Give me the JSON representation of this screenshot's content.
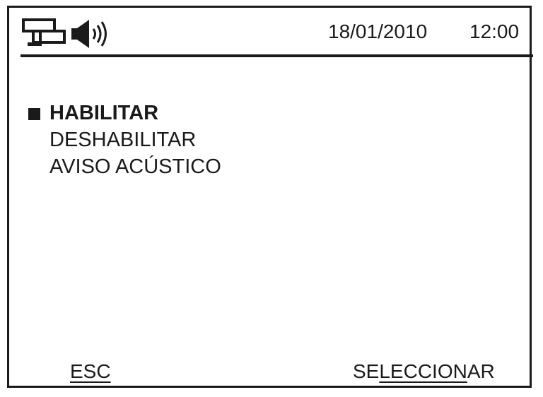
{
  "status_bar": {
    "network_icon": "network-icon",
    "speaker_icon": "speaker-icon",
    "date": "18/01/2010",
    "time": "12:00"
  },
  "menu": {
    "selected_index": 0,
    "items": [
      {
        "label": "HABILITAR",
        "selected": true
      },
      {
        "label": "DESHABILITAR",
        "selected": false
      },
      {
        "label": "AVISO ACÚSTICO",
        "selected": false
      }
    ]
  },
  "softkeys": {
    "left": {
      "label": "ESC"
    },
    "right": {
      "label_pre": "SE",
      "label_ul": "LECCION",
      "label_post": "AR"
    }
  },
  "colors": {
    "foreground": "#1a1a1a",
    "background": "#ffffff"
  }
}
